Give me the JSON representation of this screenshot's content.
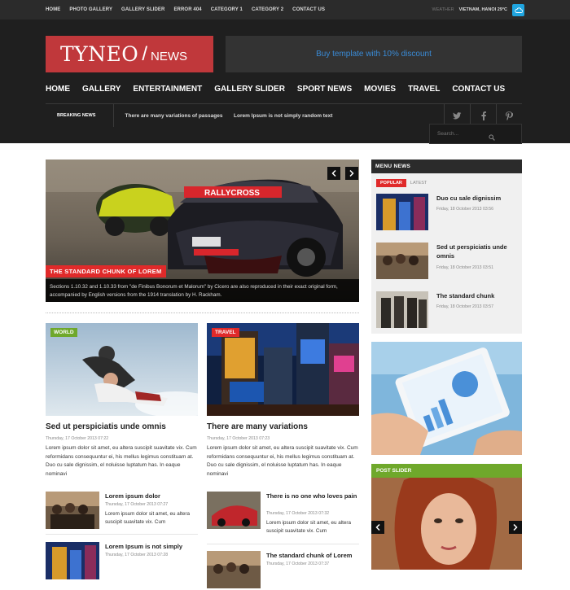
{
  "topnav": [
    "HOME",
    "PHOTO GALLERY",
    "GALLERY SLIDER",
    "ERROR 404",
    "CATEGORY 1",
    "CATEGORY 2",
    "CONTACT US"
  ],
  "weather": {
    "label": "WEATHER",
    "value": "VIETNAM, HANOI 29°C"
  },
  "logo": {
    "part1": "TYNEO",
    "slash": "/",
    "part2": "NEWS"
  },
  "promo": "Buy template with 10% discount",
  "mainnav": [
    "HOME",
    "GALLERY",
    "ENTERTAINMENT",
    "GALLERY SLIDER",
    "SPORT NEWS",
    "MOVIES",
    "TRAVEL",
    "CONTACT US"
  ],
  "breaking": {
    "label": "BREAKING NEWS",
    "items": [
      "There are many variations of passages",
      "Lorem Ipsum is not simply random text"
    ]
  },
  "search": {
    "placeholder": "Search..."
  },
  "social": [
    "twitter-icon",
    "facebook-icon",
    "pinterest-icon"
  ],
  "slider": {
    "tag": "THE STANDARD CHUNK OF LOREM",
    "caption": "Sections 1.10.32 and 1.10.33 from \"de Finibus Bonorum et Malorum\" by Cicero are also reproduced in their exact original form, accompanied by English versions from the 1914 translation by H. Rackham.",
    "banner": "RALLYCROSS"
  },
  "cards": [
    {
      "badge": "WORLD",
      "badge_color": "#6fa82b",
      "title": "Sed ut perspiciatis unde omnis",
      "date": "Thursday, 17 October 2013 07:22",
      "excerpt": "Lorem ipsum dolor sit amet, eu altera suscipit suavitate vix. Cum reformidans consequuntur ei, his mellus legimus constituam at. Duo cu sale dignissim, el noluisse luptatum has. In eaque nominavi"
    },
    {
      "badge": "TRAVEL",
      "badge_color": "#e02a2a",
      "title": "There are many variations",
      "date": "Thursday, 17 October 2013 07:23",
      "excerpt": "Lorem ipsum dolor sit amet, eu altera suscipit suavitate vix. Cum reformidans consequuntur ei, his mellus legimus constituam at. Duo cu sale dignissim, el noluisse luptatum has. In eaque nominavi"
    }
  ],
  "small_left": [
    {
      "title": "Lorem ipsum dolor",
      "date": "Thursday, 17 October 2013 07:27",
      "excerpt": "Lorem ipsum dolor sit amet, eu altera suscipit suavitate vix. Cum"
    },
    {
      "title": "Lorem Ipsum is not simply",
      "date": "Thursday, 17 October 2013 07:28",
      "excerpt": ""
    }
  ],
  "small_right": [
    {
      "title": "There is no one who loves pain",
      "date": "Thursday, 17 October 2013 07:32",
      "excerpt": "Lorem ipsum dolor sit amet, eu altera suscipit suavitate vix. Cum"
    },
    {
      "title": "The standard chunk of Lorem",
      "date": "Thursday, 17 October 2013 07:37",
      "excerpt": ""
    }
  ],
  "menu_news": {
    "title": "MENU NEWS",
    "tabs": {
      "popular": "POPULAR",
      "latest": "LATEST"
    },
    "items": [
      {
        "title": "Duo cu sale dignissim",
        "date": "Friday, 18 October 2013 03:56"
      },
      {
        "title": "Sed ut perspiciatis unde omnis",
        "date": "Friday, 18 October 2013 03:51"
      },
      {
        "title": "The standard chunk",
        "date": "Friday, 18 October 2013 03:57"
      }
    ]
  },
  "post_slider": {
    "title": "POST SLIDER"
  }
}
